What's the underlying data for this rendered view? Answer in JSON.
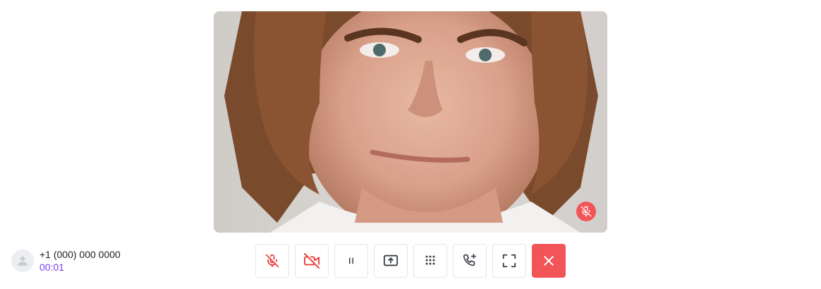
{
  "caller": {
    "number": "+1 (000) 000 0000",
    "timer": "00:01",
    "avatar_icon": "user-icon"
  },
  "video": {
    "remote_muted_icon": "mic-off-icon",
    "remote_muted_color": "#f25557"
  },
  "controls": [
    {
      "name": "mute-button",
      "icon": "mic-off-icon",
      "active_color": "#e53935"
    },
    {
      "name": "video-toggle-button",
      "icon": "video-off-icon",
      "active_color": "#e53935"
    },
    {
      "name": "hold-button",
      "icon": "pause-icon"
    },
    {
      "name": "share-screen-button",
      "icon": "screen-share-icon"
    },
    {
      "name": "dialpad-button",
      "icon": "dialpad-icon"
    },
    {
      "name": "add-call-button",
      "icon": "phone-plus-icon"
    },
    {
      "name": "fullscreen-button",
      "icon": "fullscreen-icon"
    },
    {
      "name": "end-call-button",
      "icon": "close-icon",
      "background": "#f25557"
    }
  ],
  "colors": {
    "accent": "#7a3ef0",
    "danger": "#f25557",
    "border": "#e3e5e8"
  }
}
